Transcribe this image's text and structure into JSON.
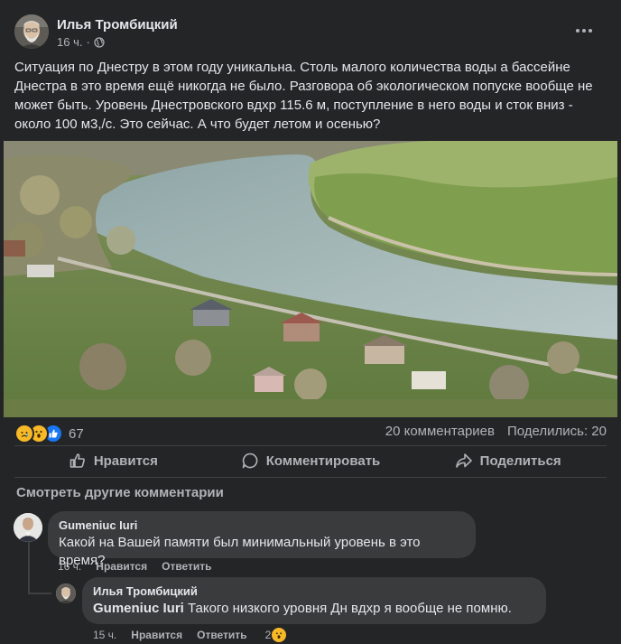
{
  "post": {
    "author": "Илья Тромбицкий",
    "time": "16 ч.",
    "privacy_icon": "globe-icon",
    "more_icon": "more-options-icon",
    "text": "Ситуация по Днестру в этом году уникальна. Столь малого количества воды а бассейне Днестра в это время ещё никогда не было. Разговора об экологическом попуске вообще не может быть. Уровень Днестровского вдхр 115.6 м, поступление в него воды и сток вниз - около 100 м3,/с. Это сейчас. А что будет летом и осенью?"
  },
  "stats": {
    "reactions": [
      "sad",
      "wow",
      "like"
    ],
    "reaction_count": "67",
    "comments": "20 комментариев",
    "shares": "Поделились: 20"
  },
  "actions": {
    "like": "Нравится",
    "comment": "Комментировать",
    "share": "Поделиться"
  },
  "view_more": "Смотреть другие комментарии",
  "comments": [
    {
      "author": "Gumeniuc Iuri",
      "text": "Какой на Вашей памяти был минимальный уровень в это время?",
      "time": "16 ч.",
      "like": "Нравится",
      "reply": "Ответить"
    }
  ],
  "reply": {
    "author": "Илья Тромбицкий",
    "tag": "Gumeniuc Iuri",
    "text": "Такого низкого уровня Дн вдхр я вообще не помню.",
    "time": "15 ч.",
    "like": "Нравится",
    "reply": "Ответить",
    "reaction_count": "2"
  },
  "colors": {
    "background": "#242526",
    "text": "#e4e6eb",
    "secondary": "#b0b3b8",
    "bubble": "#3a3b3c",
    "like_blue": "#1877f2",
    "reaction_yellow": "#f7b928"
  }
}
